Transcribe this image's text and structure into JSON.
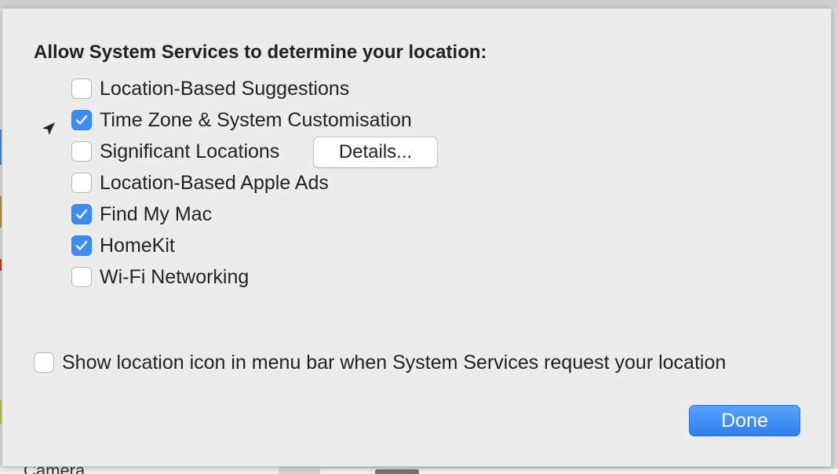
{
  "heading": "Allow System Services to determine your location:",
  "options": [
    {
      "label": "Location-Based Suggestions",
      "checked": false
    },
    {
      "label": "Time Zone & System Customisation",
      "checked": true,
      "location_indicator": "location-arrow-icon"
    },
    {
      "label": "Significant Locations",
      "checked": false,
      "button": "Details..."
    },
    {
      "label": "Location-Based Apple Ads",
      "checked": false
    },
    {
      "label": "Find My Mac",
      "checked": true
    },
    {
      "label": "HomeKit",
      "checked": true
    },
    {
      "label": "Wi-Fi Networking",
      "checked": false
    }
  ],
  "menu_bar_option": {
    "label": "Show location icon in menu bar when System Services request your location",
    "checked": false
  },
  "done_button": "Done",
  "background": {
    "sidebar_item": "Camera"
  },
  "colors": {
    "accent": "#3b8cf5",
    "sheet": "#ececec"
  }
}
